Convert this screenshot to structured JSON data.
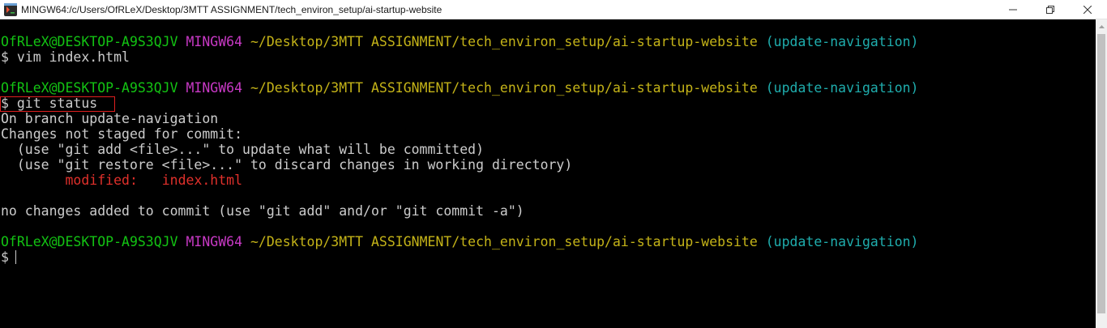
{
  "window": {
    "title": "MINGW64:/c/Users/OfRLeX/Desktop/3MTT ASSIGNMENT/tech_environ_setup/ai-startup-website",
    "icons": {
      "app": "git-bash-icon",
      "minimize": "minimize-icon",
      "maximize": "maximize-icon",
      "close": "close-icon"
    }
  },
  "colors": {
    "user_host": "#13c313",
    "env": "#c839c5",
    "path": "#c4b318",
    "branch": "#1fadad",
    "modified": "#e0302b",
    "highlight_box": "#e01f1f"
  },
  "prompt": {
    "user_host": "OfRLeX@DESKTOP-A9S3QJV",
    "env": "MINGW64",
    "path": "~/Desktop/3MTT ASSIGNMENT/tech_environ_setup/ai-startup-website",
    "branch": "(update-navigation)",
    "symbol": "$"
  },
  "commands": {
    "first": "vim index.html",
    "second": "git status"
  },
  "output": {
    "on_branch": "On branch update-navigation",
    "not_staged": "Changes not staged for commit:",
    "hint_add": "  (use \"git add <file>...\" to update what will be committed)",
    "hint_restore": "  (use \"git restore <file>...\" to discard changes in working directory)",
    "modified_indent": "        ",
    "modified_label": "modified:",
    "modified_spacer": "   ",
    "modified_file": "index.html",
    "no_changes": "no changes added to commit (use \"git add\" and/or \"git commit -a\")"
  }
}
